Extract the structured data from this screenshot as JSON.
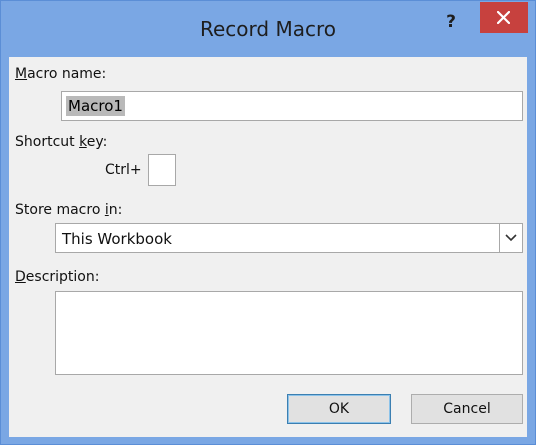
{
  "window": {
    "title": "Record Macro",
    "help_label": "?"
  },
  "form": {
    "macro_name_label_pre": "",
    "macro_name_label_u": "M",
    "macro_name_label_post": "acro name:",
    "macro_name_value": "Macro1",
    "shortcut_label_pre": "Shortcut ",
    "shortcut_label_u": "k",
    "shortcut_label_post": "ey:",
    "ctrl_label": "Ctrl+",
    "shortcut_value": "",
    "store_label_pre": "Store macro ",
    "store_label_u": "i",
    "store_label_post": "n:",
    "store_value": "This Workbook",
    "description_label_pre": "",
    "description_label_u": "D",
    "description_label_post": "escription:",
    "description_value": ""
  },
  "buttons": {
    "ok_label": "OK",
    "cancel_label": "Cancel"
  },
  "icons": {
    "close": "close-icon",
    "dropdown": "chevron-down-icon"
  },
  "colors": {
    "title_bar": "#7aa7e4",
    "close_button": "#c7413e",
    "client_bg": "#f0f0f0"
  }
}
